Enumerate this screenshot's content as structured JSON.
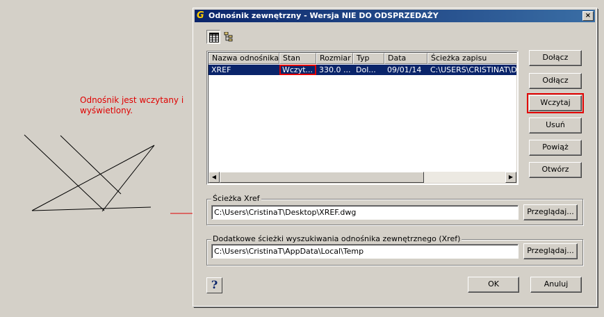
{
  "annotation": {
    "line1": "Odnośnik jest wczytany i",
    "line2": "wyświetlony.",
    "color": "#e00000"
  },
  "dialog": {
    "title": "Odnośnik zewnętrzny - Wersja NIE DO ODSPRZEDAŻY",
    "close_label": "×",
    "toolbar": {
      "list_view_icon": "list-view-icon",
      "tree_view_icon": "tree-view-icon"
    },
    "table": {
      "columns": [
        "Nazwa odnośnika",
        "Stan",
        "Rozmiar",
        "Typ",
        "Data",
        "Ścieżka zapisu"
      ],
      "rows": [
        [
          "XREF",
          "Wczyt...",
          "330.0 ...",
          "Dol...",
          "09/01/14",
          "C:\\USERS\\CRISTINAT\\D"
        ]
      ]
    },
    "buttons": {
      "attach": "Dołącz",
      "detach": "Odłącz",
      "reload": "Wczytaj",
      "unload": "Usuń",
      "bind": "Powiąż",
      "open": "Otwórz"
    },
    "xref_path": {
      "label": "Ścieżka Xref",
      "value": "C:\\Users\\CristinaT\\Desktop\\XREF.dwg",
      "browse": "Przeglądaj..."
    },
    "search_paths": {
      "label": "Dodatkowe ścieżki wyszukiwania odnośnika zewnętrznego (Xref)",
      "value": "C:\\Users\\CristinaT\\AppData\\Local\\Temp",
      "browse": "Przeglądaj..."
    },
    "help_label": "?",
    "ok": "OK",
    "cancel": "Anuluj",
    "accent": "#0a246a"
  }
}
